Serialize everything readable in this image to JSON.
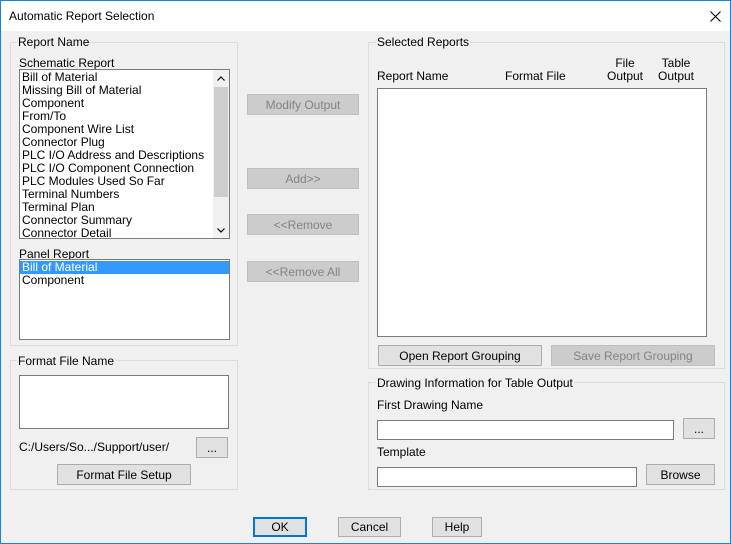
{
  "window": {
    "title": "Automatic Report Selection",
    "close_glyph": "close-icon"
  },
  "report_name": {
    "group_label": "Report Name",
    "schematic_label": "Schematic Report",
    "schematic_items": [
      "Bill of Material",
      "Missing Bill of Material",
      "Component",
      "From/To",
      "Component Wire List",
      "Connector Plug",
      "PLC I/O Address and Descriptions",
      "PLC I/O Component Connection",
      "PLC Modules Used So Far",
      "Terminal Numbers",
      "Terminal Plan",
      "Connector Summary",
      "Connector Detail"
    ],
    "panel_label": "Panel Report",
    "panel_items": [
      "Bill of Material",
      "Component"
    ],
    "panel_selected_index": 0
  },
  "format_file": {
    "group_label": "Format File Name",
    "path": "C:/Users/So.../Support/user/",
    "browse_label": "...",
    "setup_label": "Format File Setup"
  },
  "middle_buttons": {
    "modify_output": "Modify Output",
    "add": "Add>>",
    "remove": "<<Remove",
    "remove_all": "<<Remove All"
  },
  "selected_reports": {
    "group_label": "Selected Reports",
    "col_report_name": "Report Name",
    "col_format_file": "Format File",
    "col_file_output_1": "File",
    "col_file_output_2": "Output",
    "col_table_output_1": "Table",
    "col_table_output_2": "Output",
    "open_grouping": "Open Report Grouping",
    "save_grouping": "Save Report Grouping"
  },
  "drawing_info": {
    "group_label": "Drawing Information for Table Output",
    "first_drawing_label": "First Drawing Name",
    "first_drawing_value": "",
    "first_drawing_browse": "...",
    "template_label": "Template",
    "template_value": "",
    "template_browse": "Browse"
  },
  "footer": {
    "ok": "OK",
    "cancel": "Cancel",
    "help": "Help"
  },
  "colors": {
    "selection": "#3399ff",
    "accent_border": "#0078d7",
    "window_border": "#1883d7"
  }
}
